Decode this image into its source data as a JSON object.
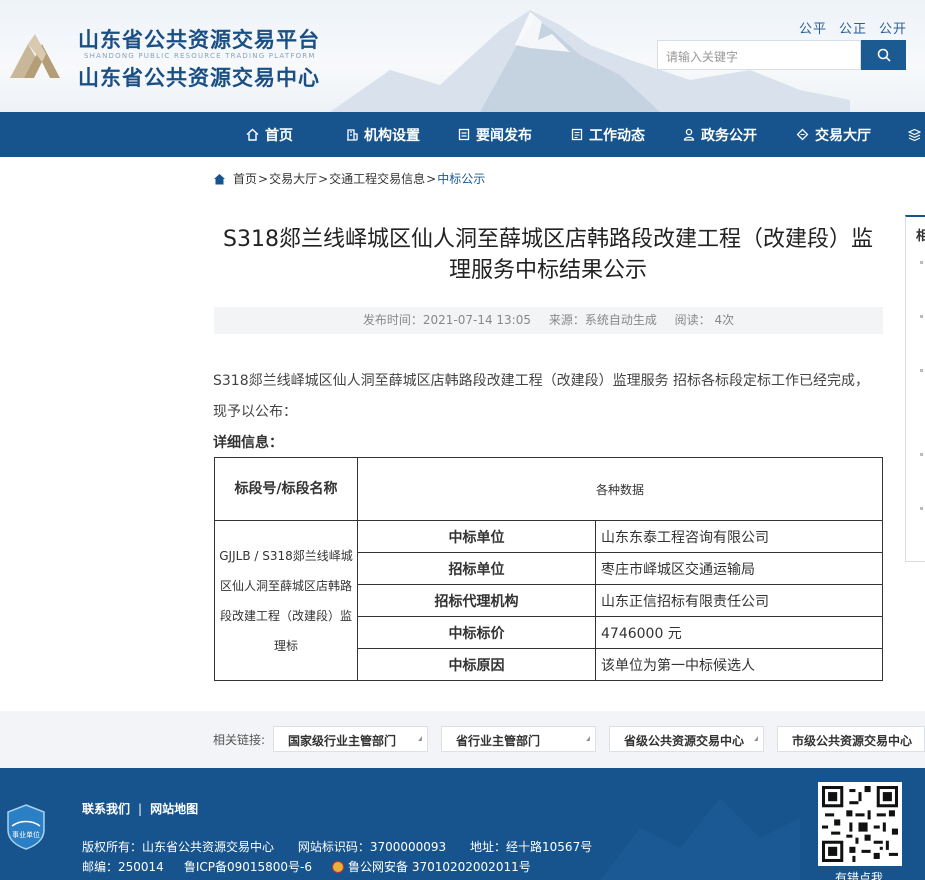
{
  "header": {
    "title_line1": "山东省公共资源交易平台",
    "title_en": "SHANDONG PUBLIC RESOURCE TRADING PLATFORM",
    "title_line2": "山东省公共资源交易中心",
    "slogans": [
      "公平",
      "公正",
      "公开"
    ],
    "search_placeholder": "请输入关键字",
    "brand_color": "#17548d"
  },
  "nav": {
    "items": [
      {
        "label": "首页",
        "icon": "home-icon"
      },
      {
        "label": "机构设置",
        "icon": "building-icon"
      },
      {
        "label": "要闻发布",
        "icon": "news-icon"
      },
      {
        "label": "工作动态",
        "icon": "list-icon"
      },
      {
        "label": "政务公开",
        "icon": "person-icon"
      },
      {
        "label": "交易大厅",
        "icon": "diamond-icon"
      }
    ]
  },
  "breadcrumb": {
    "items": [
      "首页",
      "交易大厅",
      "交通工程交易信息"
    ],
    "separator": ">",
    "current": "中标公示"
  },
  "article": {
    "title": "S318郯兰线峄城区仙人洞至薛城区店韩路段改建工程（改建段）监理服务中标结果公示",
    "meta": {
      "publish": "发布时间：2021-07-14 13:05",
      "source": "来源：系统自动生成",
      "reads": "阅读： 4次"
    },
    "intro": "S318郯兰线峄城区仙人洞至薛城区店韩路段改建工程（改建段）监理服务 招标各标段定标工作已经完成，现予以公布：",
    "detail_label": "详细信息："
  },
  "table": {
    "head_col": "标段号/标段名称",
    "head_data": "各种数据",
    "section_name": "GJJLB / S318郯兰线峄城区仙人洞至薛城区店韩路段改建工程（改建段）监理标",
    "rows": [
      {
        "key": "中标单位",
        "value": "山东东泰工程咨询有限公司"
      },
      {
        "key": "招标单位",
        "value": "枣庄市峄城区交通运输局"
      },
      {
        "key": "招标代理机构",
        "value": "山东正信招标有限责任公司"
      },
      {
        "key": "中标标价",
        "value": "4746000 元"
      },
      {
        "key": "中标原因",
        "value": "该单位为第一中标候选人"
      }
    ]
  },
  "side_panel": {
    "title": "相"
  },
  "related": {
    "label": "相关链接:",
    "selects": [
      "国家级行业主管部门",
      "省行业主管部门",
      "省级公共资源交易中心",
      "市级公共资源交易中心"
    ]
  },
  "footer": {
    "badge_text": "事业单位",
    "links": [
      "联系我们",
      "网站地图"
    ],
    "copyright": "版权所有：山东省公共资源交易中心",
    "site_id": "网站标识码：3700000093",
    "address": "地址：经十路10567号",
    "postcode": "邮编：250014",
    "icp": "鲁ICP备09015800号-6",
    "police": "鲁公网安备 37010202002011号",
    "qr_caption": "有错点我"
  }
}
